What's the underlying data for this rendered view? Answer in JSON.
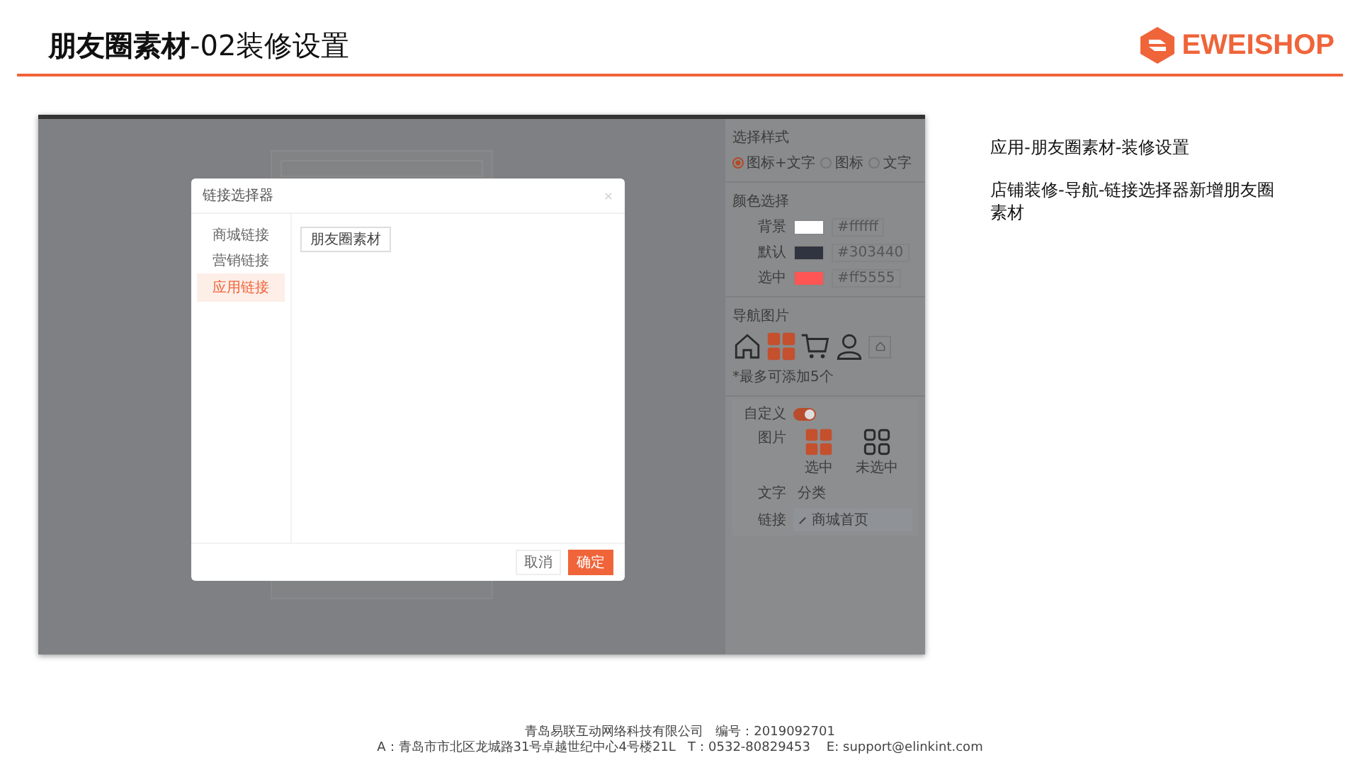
{
  "header": {
    "title": "**朋友圈素材**-02装修设置",
    "logo": "EWEISHOP"
  },
  "screenshot": {
    "panel": {
      "style_title": "选择样式",
      "styles": [
        {
          "label": "图标+文字",
          "selected": true
        },
        {
          "label": "图标",
          "selected": false
        },
        {
          "label": "文字",
          "selected": false
        }
      ],
      "color_title": "颜色选择",
      "colors": [
        {
          "label": "背景",
          "color": "#ffffff",
          "value": "#ffffff"
        },
        {
          "label": "默认",
          "color": "#303440",
          "value": "#303440"
        },
        {
          "label": "选中",
          "color": "#ff5555",
          "value": "#ff5555"
        }
      ],
      "nav_title": "导航图片",
      "nav_icons": [
        {
          "kind": "home",
          "selected": false
        },
        {
          "kind": "grid",
          "selected": true
        },
        {
          "kind": "cart",
          "selected": false
        },
        {
          "kind": "user",
          "selected": false
        },
        {
          "kind": "add",
          "selected": false
        }
      ],
      "hint": "*最多可添加5个",
      "custom_label": "自定义",
      "custom_on": true,
      "image_label": "图片",
      "images": [
        {
          "label": "选中",
          "selected": true
        },
        {
          "label": "未选中",
          "selected": false
        }
      ],
      "text_label": "文字",
      "text_value": "分类",
      "link_label": "链接",
      "link_value": "商城首页"
    },
    "dialog": {
      "title": "链接选择器",
      "nav": [
        {
          "label": "商城链接",
          "selected": false
        },
        {
          "label": "营销链接",
          "selected": false
        },
        {
          "label": "应用链接",
          "selected": true
        }
      ],
      "options": [
        "朋友圈素材"
      ],
      "cancel": "取消",
      "ok": "确定"
    }
  },
  "notes": [
    "应用-朋友圈素材-装修设置",
    "店铺装修-导航-链接选择器新增朋友圈素材"
  ],
  "footer": [
    "青岛易联互动网络科技有限公司   编号：2019092701",
    "A：青岛市市北区龙城路31号卓越世纪中心4号楼21L   T：0532-80829453    E: support@elinkint.com"
  ]
}
